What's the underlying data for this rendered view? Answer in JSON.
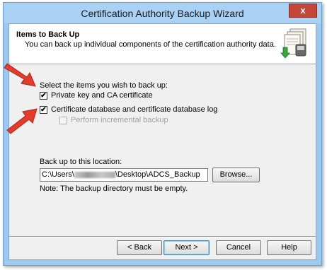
{
  "window": {
    "title": "Certification Authority Backup Wizard",
    "close_glyph": "x"
  },
  "header": {
    "title": "Items to Back Up",
    "subtitle": "You can back up individual components of the certification authority data.",
    "icon": "ca-backup-icon"
  },
  "items": {
    "prompt": "Select the items you wish to back up:",
    "private_key": {
      "label": "Private key and CA certificate",
      "checked": true
    },
    "cert_db": {
      "label": "Certificate database and certificate database log",
      "checked": true
    },
    "incremental": {
      "label": "Perform incremental backup",
      "checked": false,
      "enabled": false
    }
  },
  "location": {
    "label": "Back up to this location:",
    "path_prefix": "C:\\Users\\",
    "path_suffix": "\\Desktop\\ADCS_Backup",
    "browse_label": "Browse...",
    "note": "Note: The backup directory must be empty."
  },
  "footer": {
    "back_label": "< Back",
    "next_label": "Next >",
    "cancel_label": "Cancel",
    "help_label": "Help"
  },
  "colors": {
    "title_bar": "#a9d1f4",
    "close_button": "#c7463a",
    "annotation_arrow": "#e53b2c"
  }
}
